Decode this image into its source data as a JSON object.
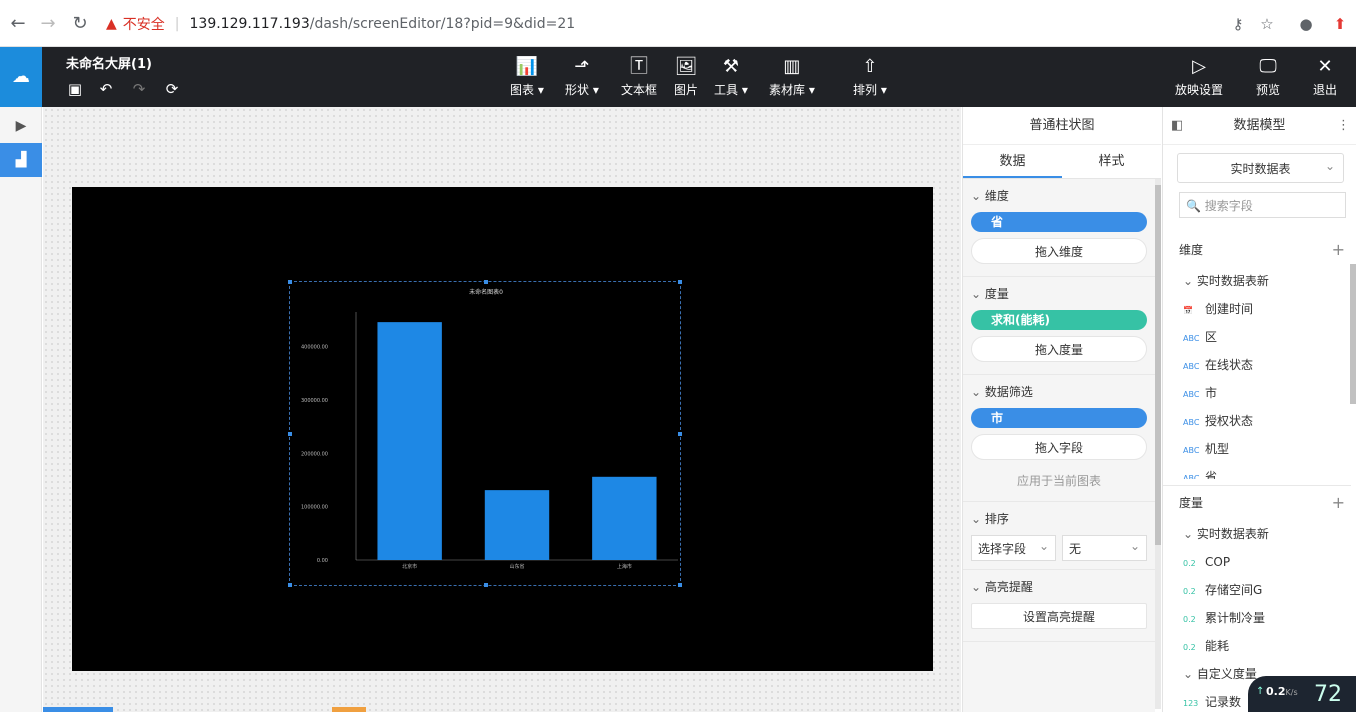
{
  "browser": {
    "insecure_label": "不安全",
    "url_host": "139.129.117.193",
    "url_path": "/dash/screenEditor/18?pid=9&did=21"
  },
  "header": {
    "title": "未命名大屏(1)",
    "tools": [
      {
        "label": "图表",
        "icon": "bar-chart-icon",
        "dropdown": true
      },
      {
        "label": "形状",
        "icon": "shape-icon",
        "dropdown": true
      },
      {
        "label": "文本框",
        "icon": "textbox-icon",
        "dropdown": false
      },
      {
        "label": "图片",
        "icon": "image-icon",
        "dropdown": false
      },
      {
        "label": "工具",
        "icon": "hammer-icon",
        "dropdown": true
      },
      {
        "label": "素材库",
        "icon": "library-icon",
        "dropdown": true
      },
      {
        "label": "排列",
        "icon": "arrange-icon",
        "dropdown": true
      }
    ],
    "right_tools": [
      {
        "label": "放映设置",
        "icon": "play-settings-icon"
      },
      {
        "label": "预览",
        "icon": "preview-icon"
      },
      {
        "label": "退出",
        "icon": "close-icon"
      }
    ]
  },
  "chart_data": {
    "type": "bar",
    "title": "未命名图表0",
    "categories": [
      "北京市",
      "山东省",
      "上海市"
    ],
    "values": [
      446000,
      131000,
      156000
    ],
    "yticks": [
      "0.00",
      "100000.00",
      "200000.00",
      "300000.00",
      "400000.00"
    ],
    "ylim": [
      0,
      480000
    ],
    "bar_color": "#1e88e5",
    "grid": false
  },
  "props": {
    "title": "普通柱状图",
    "tabs": [
      "数据",
      "样式"
    ],
    "dimension": {
      "header": "维度",
      "pill": "省",
      "drop": "拖入维度"
    },
    "measure": {
      "header": "度量",
      "pill": "求和(能耗)",
      "drop": "拖入度量"
    },
    "filter": {
      "header": "数据筛选",
      "pill": "市",
      "drop": "拖入字段",
      "apply": "应用于当前图表"
    },
    "sort": {
      "header": "排序",
      "field_select": "选择字段",
      "order_select": "无"
    },
    "highlight": {
      "header": "高亮提醒",
      "button": "设置高亮提醒"
    }
  },
  "model": {
    "title": "数据模型",
    "source_select": "实时数据表",
    "search_placeholder": "搜索字段",
    "dimensions": {
      "header": "维度",
      "table": "实时数据表新",
      "fields": [
        {
          "type": "date",
          "name": "创建时间"
        },
        {
          "type": "ABC",
          "name": "区"
        },
        {
          "type": "ABC",
          "name": "在线状态"
        },
        {
          "type": "ABC",
          "name": "市"
        },
        {
          "type": "ABC",
          "name": "授权状态"
        },
        {
          "type": "ABC",
          "name": "机型"
        },
        {
          "type": "ABC",
          "name": "省"
        }
      ]
    },
    "measures": {
      "header": "度量",
      "table": "实时数据表新",
      "fields": [
        {
          "type": "0.2",
          "name": "COP"
        },
        {
          "type": "0.2",
          "name": "存储空间G"
        },
        {
          "type": "0.2",
          "name": "累计制冷量"
        },
        {
          "type": "0.2",
          "name": "能耗"
        }
      ],
      "custom_header": "自定义度量",
      "custom_fields": [
        {
          "type": "123",
          "name": "记录数"
        }
      ]
    }
  },
  "status": {
    "speed": "0.2",
    "speed_unit": "K/s",
    "percent": "72"
  }
}
